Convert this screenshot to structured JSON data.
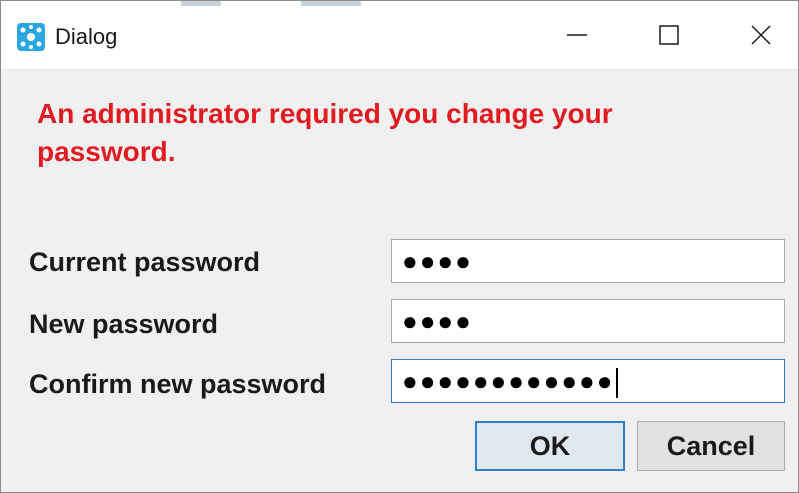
{
  "window": {
    "title": "Dialog",
    "icon": "app-dots-icon",
    "controls": {
      "minimize": "minimize-icon",
      "maximize": "maximize-icon",
      "close": "close-icon"
    }
  },
  "message": "An administrator required you change your password.",
  "form": {
    "current_label": "Current password",
    "current_value": "●●●●",
    "new_label": "New password",
    "new_value": "●●●●",
    "confirm_label": "Confirm new password",
    "confirm_value": "●●●●●●●●●●●●"
  },
  "buttons": {
    "ok_label": "OK",
    "cancel_label": "Cancel"
  },
  "colors": {
    "message": "#e11b22",
    "focus_border": "#2f7fd1",
    "icon": "#2aa6e0"
  }
}
